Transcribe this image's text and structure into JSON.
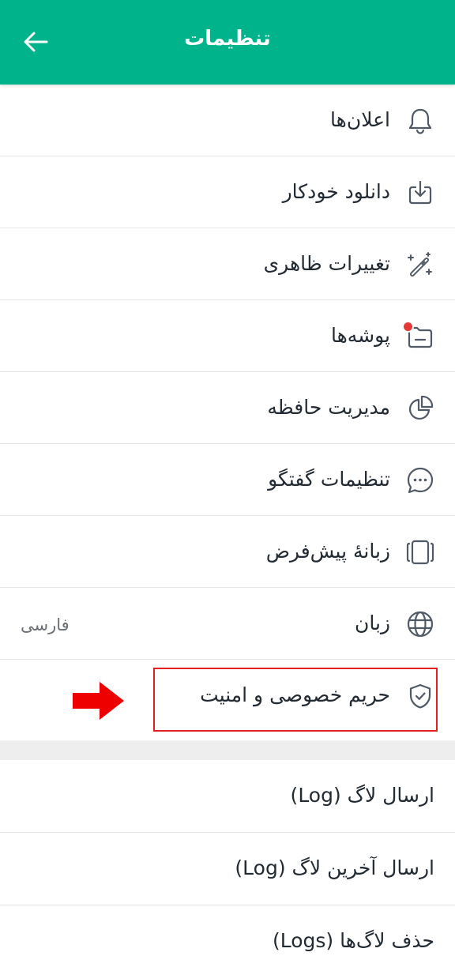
{
  "app_bar": {
    "title": "تنظیمات",
    "back_icon": "arrow-left-icon",
    "background_color": "#00b38a"
  },
  "settings": [
    {
      "label": "اعلان‌ها",
      "icon": "bell-icon"
    },
    {
      "label": "دانلود خودکار",
      "icon": "download-icon"
    },
    {
      "label": "تغییرات ظاهری",
      "icon": "magic-wand-icon"
    },
    {
      "label": "پوشه‌ها",
      "icon": "folder-icon",
      "badge_color": "#e53935"
    },
    {
      "label": "مدیریت حافظه",
      "icon": "pie-chart-icon"
    },
    {
      "label": "تنظیمات گفتگو",
      "icon": "chat-bubble-icon"
    },
    {
      "label": "زبانهٔ پیش‌فرض",
      "icon": "tabs-icon"
    },
    {
      "label": "زبان",
      "icon": "globe-icon",
      "value": "فارسی"
    },
    {
      "label": "حریم خصوصی و امنیت",
      "icon": "shield-icon",
      "highlighted": true
    }
  ],
  "log_actions": [
    {
      "label": "ارسال لاگ (Log)"
    },
    {
      "label": "ارسال آخرین لاگ (Log)"
    },
    {
      "label": "حذف لاگ‌ها (Logs)"
    }
  ],
  "annotation": {
    "arrow_color": "#ee0000",
    "box_color": "#e02020"
  }
}
